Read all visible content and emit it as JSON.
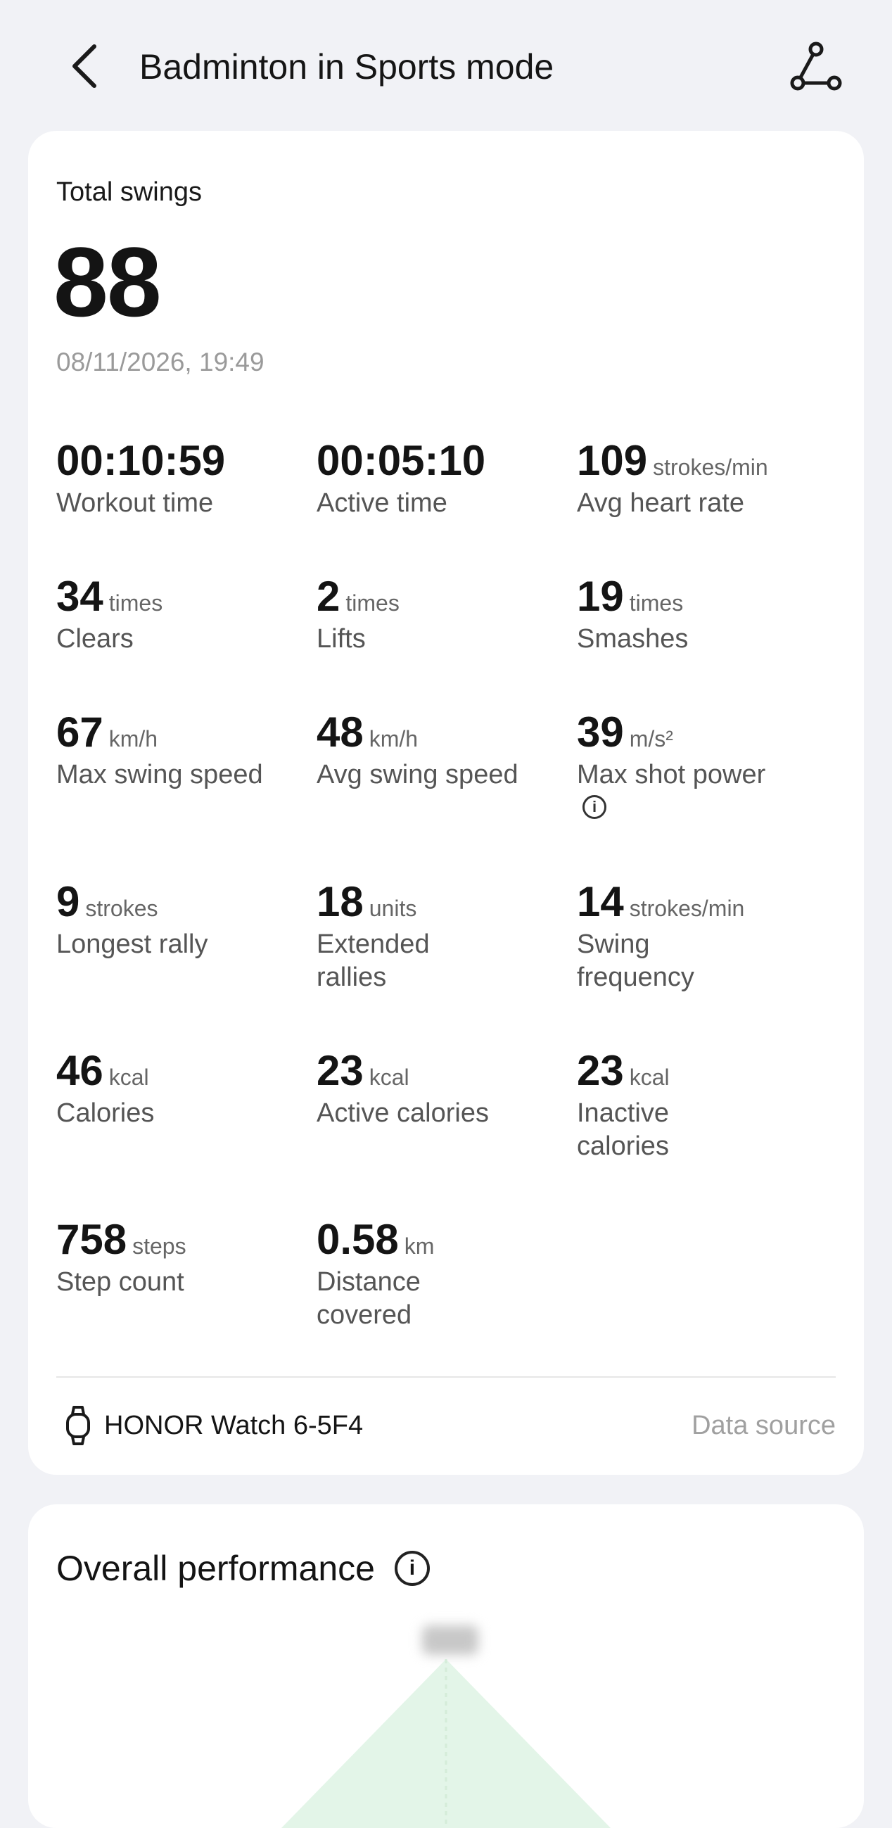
{
  "header": {
    "title": "Badminton in Sports mode"
  },
  "summary": {
    "total_label": "Total swings",
    "total_value": "88",
    "date": "08/11/2026, 19:49"
  },
  "metrics": [
    {
      "value": "00:10:59",
      "unit": "",
      "label": "Workout time"
    },
    {
      "value": "00:05:10",
      "unit": "",
      "label": "Active time"
    },
    {
      "value": "109",
      "unit": "strokes/min",
      "label": "Avg heart rate"
    },
    {
      "value": "34",
      "unit": "times",
      "label": "Clears"
    },
    {
      "value": "2",
      "unit": "times",
      "label": "Lifts"
    },
    {
      "value": "19",
      "unit": "times",
      "label": "Smashes"
    },
    {
      "value": "67",
      "unit": "km/h",
      "label": "Max swing speed"
    },
    {
      "value": "48",
      "unit": "km/h",
      "label": "Avg swing speed"
    },
    {
      "value": "39",
      "unit": "m/s²",
      "label": "Max shot power"
    },
    {
      "value": "9",
      "unit": "strokes",
      "label": "Longest rally"
    },
    {
      "value": "18",
      "unit": "units",
      "label": "Extended rallies"
    },
    {
      "value": "14",
      "unit": "strokes/min",
      "label": "Swing frequency"
    },
    {
      "value": "46",
      "unit": "kcal",
      "label": "Calories"
    },
    {
      "value": "23",
      "unit": "kcal",
      "label": "Active calories"
    },
    {
      "value": "23",
      "unit": "kcal",
      "label": "Inactive calories"
    },
    {
      "value": "758",
      "unit": "steps",
      "label": "Step count"
    },
    {
      "value": "0.58",
      "unit": "km",
      "label": "Distance covered"
    }
  ],
  "device": {
    "name": "HONOR Watch 6-5F4",
    "source_label": "Data source"
  },
  "performance": {
    "title": "Overall performance",
    "info_glyph": "i"
  },
  "info_glyph": "i",
  "colors": {
    "background": "#f1f2f6",
    "card": "#ffffff",
    "radar_fill": "#e3f5e8"
  }
}
